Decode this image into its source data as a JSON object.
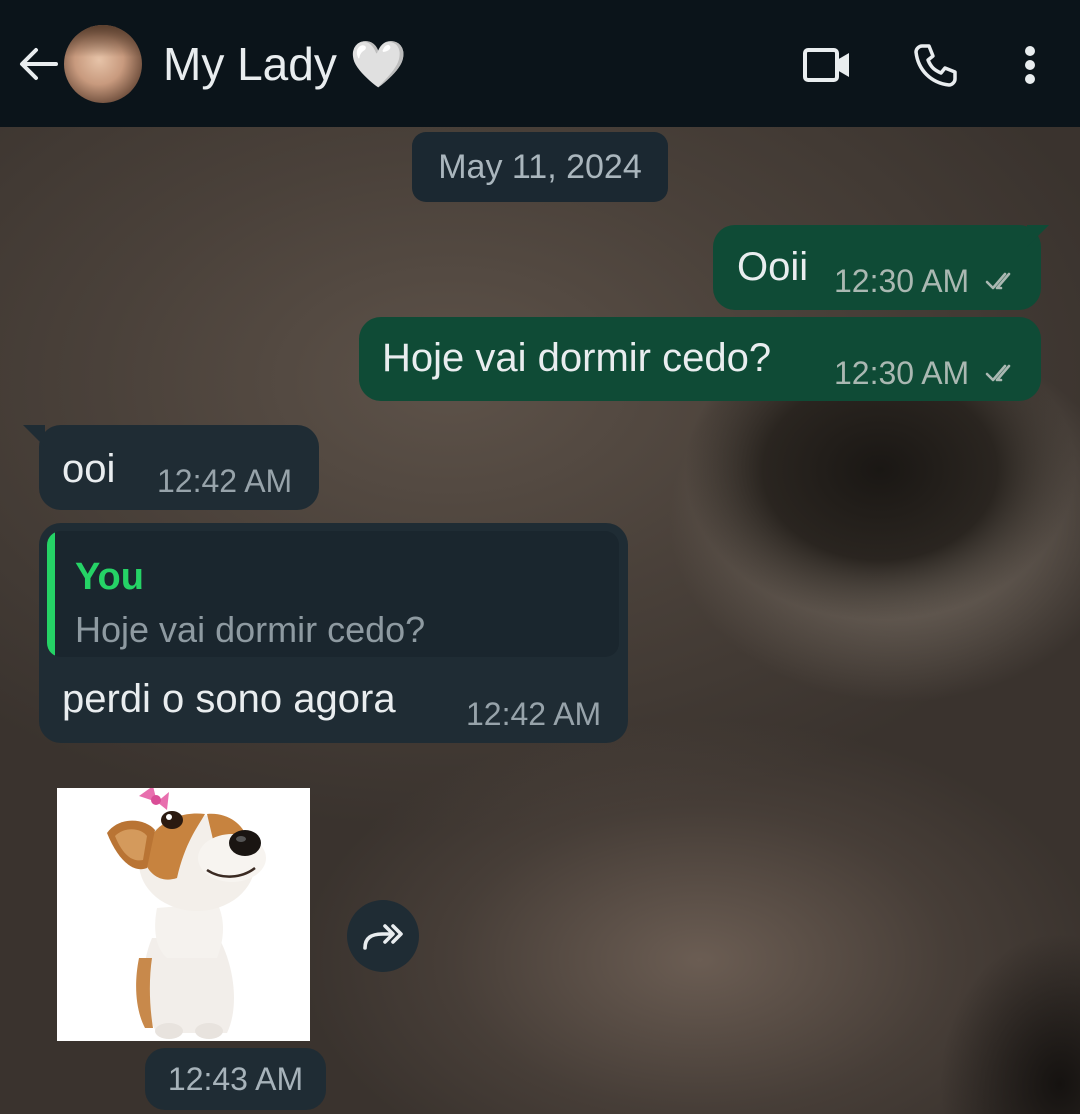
{
  "header": {
    "contact_name": "My Lady 🤍",
    "icons": [
      "back-arrow-icon",
      "video-call-icon",
      "voice-call-icon",
      "more-vert-icon"
    ]
  },
  "date_separator": "May 11, 2024",
  "messages": [
    {
      "direction": "outgoing",
      "text": "Ooii",
      "time": "12:30 AM",
      "status": "read"
    },
    {
      "direction": "outgoing",
      "text": "Hoje vai dormir cedo?",
      "time": "12:30 AM",
      "status": "read"
    },
    {
      "direction": "incoming",
      "text": "ooi",
      "time": "12:42 AM"
    },
    {
      "direction": "incoming",
      "text": "perdi o sono agora",
      "time": "12:42 AM",
      "reply_to": {
        "author": "You",
        "text": "Hoje vai dormir cedo?"
      }
    },
    {
      "direction": "incoming",
      "type": "sticker",
      "sticker": "dog-with-pink-bow",
      "time": "12:43 AM"
    }
  ],
  "colors": {
    "header_bg": "#0b141a",
    "outgoing_bubble": "#0f4b36",
    "incoming_bubble": "#1f2c34",
    "accent_green": "#25d366",
    "tick_color": "#aab8b2"
  }
}
